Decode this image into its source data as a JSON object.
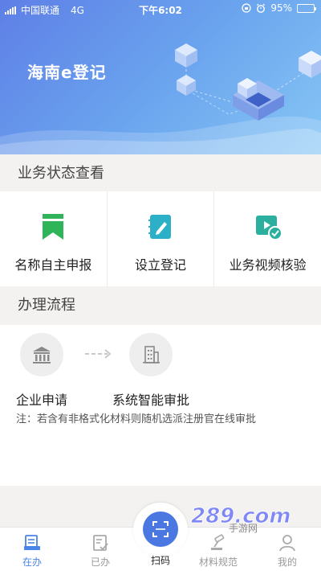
{
  "status_bar": {
    "carrier": "中国联通",
    "network": "4G",
    "time": "下午6:02",
    "battery": "95%",
    "battery_level": 0.95
  },
  "header": {
    "title": "海南e登记"
  },
  "status_section": {
    "title": "业务状态查看"
  },
  "actions": [
    {
      "label": "名称自主申报",
      "icon": "bookmark-icon",
      "color": "#2fb45a"
    },
    {
      "label": "设立登记",
      "icon": "edit-note-icon",
      "color": "#2bb0c8"
    },
    {
      "label": "业务视频核验",
      "icon": "video-check-icon",
      "color": "#2bb0a0"
    }
  ],
  "process_section": {
    "title": "办理流程"
  },
  "process": {
    "steps": [
      {
        "label": "企业申请",
        "icon": "bank-icon"
      },
      {
        "label": "系统智能审批",
        "icon": "building-icon"
      }
    ],
    "note": "注：若含有非格式化材料则随机选派注册官在线审批"
  },
  "tabbar": {
    "tabs": [
      {
        "label": "在办",
        "icon": "in-progress-icon",
        "active": true
      },
      {
        "label": "已办",
        "icon": "done-icon",
        "active": false
      },
      {
        "label": "材料规范",
        "icon": "gavel-icon",
        "active": false
      },
      {
        "label": "我的",
        "icon": "profile-icon",
        "active": false
      }
    ],
    "scan_label": "扫码"
  },
  "watermark": {
    "logo": "289.com",
    "text": "手游网"
  },
  "colors": {
    "accent": "#4a78e0",
    "header_start": "#5e7fe6",
    "header_end": "#86c6f5"
  }
}
